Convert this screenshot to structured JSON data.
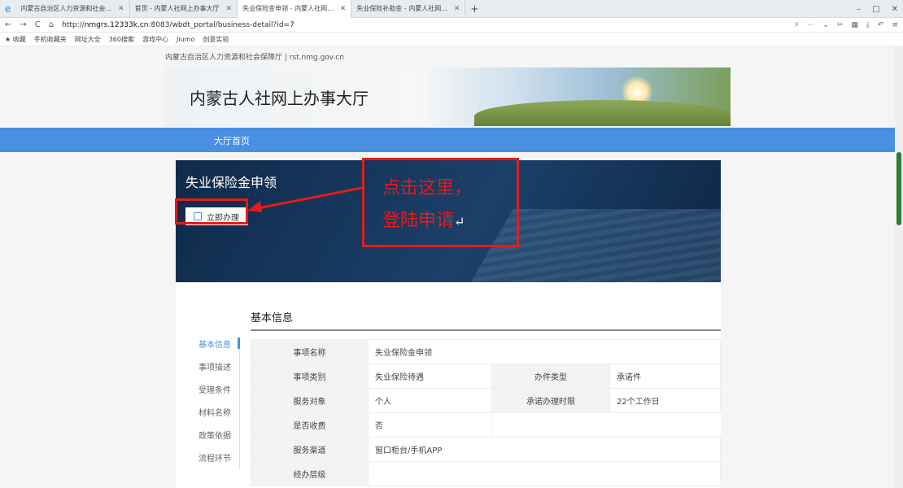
{
  "browser": {
    "tabs": [
      {
        "label": "内蒙古自治区人力资源和社会..."
      },
      {
        "label": "首页 - 内蒙人社网上办事大厅"
      },
      {
        "label": "失业保险金申领 - 内蒙人社网..."
      },
      {
        "label": "失业保险补助金 - 内蒙人社网..."
      }
    ],
    "new_tab": "+",
    "url_prefix": "http://",
    "url_host": "nmgrs.12333k.cn",
    "url_path": ":8083/wbdt_portal/business-detail?id=7",
    "bookmarks": [
      "收藏",
      "手机收藏夹",
      "网址大全",
      "360搜索",
      "游戏中心",
      "Jiumo",
      "创意实验"
    ]
  },
  "page": {
    "top_link": "内蒙古自治区人力资源和社会保障厅 | rst.nmg.gov.cn",
    "banner_title": "内蒙古人社网上办事大厅",
    "nav_home": "大厅首页",
    "hero_title": "失业保险金申领",
    "apply_button": "立即办理",
    "callout_line1": "点击这里，",
    "callout_line2": "登陆申请",
    "section_title": "基本信息",
    "side_menu": [
      "基本信息",
      "事项描述",
      "受理条件",
      "材料名称",
      "政策依据",
      "流程环节"
    ],
    "table": {
      "r1": {
        "k": "事项名称",
        "v": "失业保险金申领"
      },
      "r2": {
        "k": "事项类别",
        "v": "失业保险待遇",
        "k2": "办件类型",
        "v2": "承诺件"
      },
      "r3": {
        "k": "服务对象",
        "v": "个人",
        "k2": "承诺办理时限",
        "v2": "22个工作日"
      },
      "r4": {
        "k": "是否收费",
        "v": "否"
      },
      "r5": {
        "k": "服务渠道",
        "v": "窗口柜台/手机APP"
      },
      "r6": {
        "k": "经办层级",
        "v": ""
      }
    }
  },
  "colors": {
    "nav": "#4a90e2",
    "annotation": "#e51b1b"
  }
}
